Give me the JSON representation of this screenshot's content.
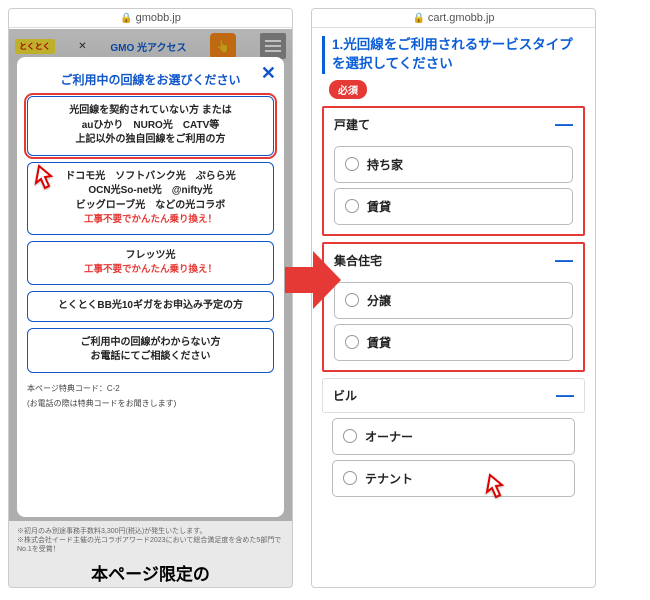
{
  "left": {
    "url": "gmobb.jp",
    "logo_a": "とくとく",
    "logo_b": "GMO 光アクセス",
    "modal_title": "ご利用中の回線をお選びください",
    "options": [
      {
        "lines": [
          "光回線を契約されていない方 または",
          "auひかり　NURO光　CATV等",
          "上記以外の独自回線をご利用の方"
        ],
        "highlight": true
      },
      {
        "lines": [
          "ドコモ光　ソフトバンク光　ぷらら光",
          "OCN光So-net光　@nifty光",
          "ビッグローブ光　などの光コラボ"
        ],
        "sub": "工事不要でかんたん乗り換え！"
      },
      {
        "lines": [
          "フレッツ光"
        ],
        "sub": "工事不要でかんたん乗り換え！"
      },
      {
        "lines": [
          "とくとくBB光10ギガをお申込み予定の方"
        ]
      },
      {
        "lines": [
          "ご利用中の回線がわからない方",
          "お電話にてご相談ください"
        ]
      }
    ],
    "foot1": "本ページ特典コード：C-2",
    "foot2": "(お電話の際は特典コードをお聞きします)",
    "disclaim1": "※初月のみ別途事務手数料3,300円(税込)が発生いたします。",
    "disclaim2": "※株式会社イード主催の光コラボアワード2023において総合満足度を含めた5部門でNo.1を受賞！",
    "big_head": "本ページ限定の"
  },
  "right": {
    "url": "cart.gmobb.jp",
    "title": "1.光回線をご利用されるサービスタイプを選択してください",
    "required": "必須",
    "groups": [
      {
        "name": "戸建て",
        "items": [
          "持ち家",
          "賃貸"
        ],
        "boxed": true
      },
      {
        "name": "集合住宅",
        "items": [
          "分譲",
          "賃貸"
        ],
        "boxed": true
      },
      {
        "name": "ビル",
        "items": [
          "オーナー",
          "テナント"
        ],
        "boxed": false
      }
    ]
  }
}
